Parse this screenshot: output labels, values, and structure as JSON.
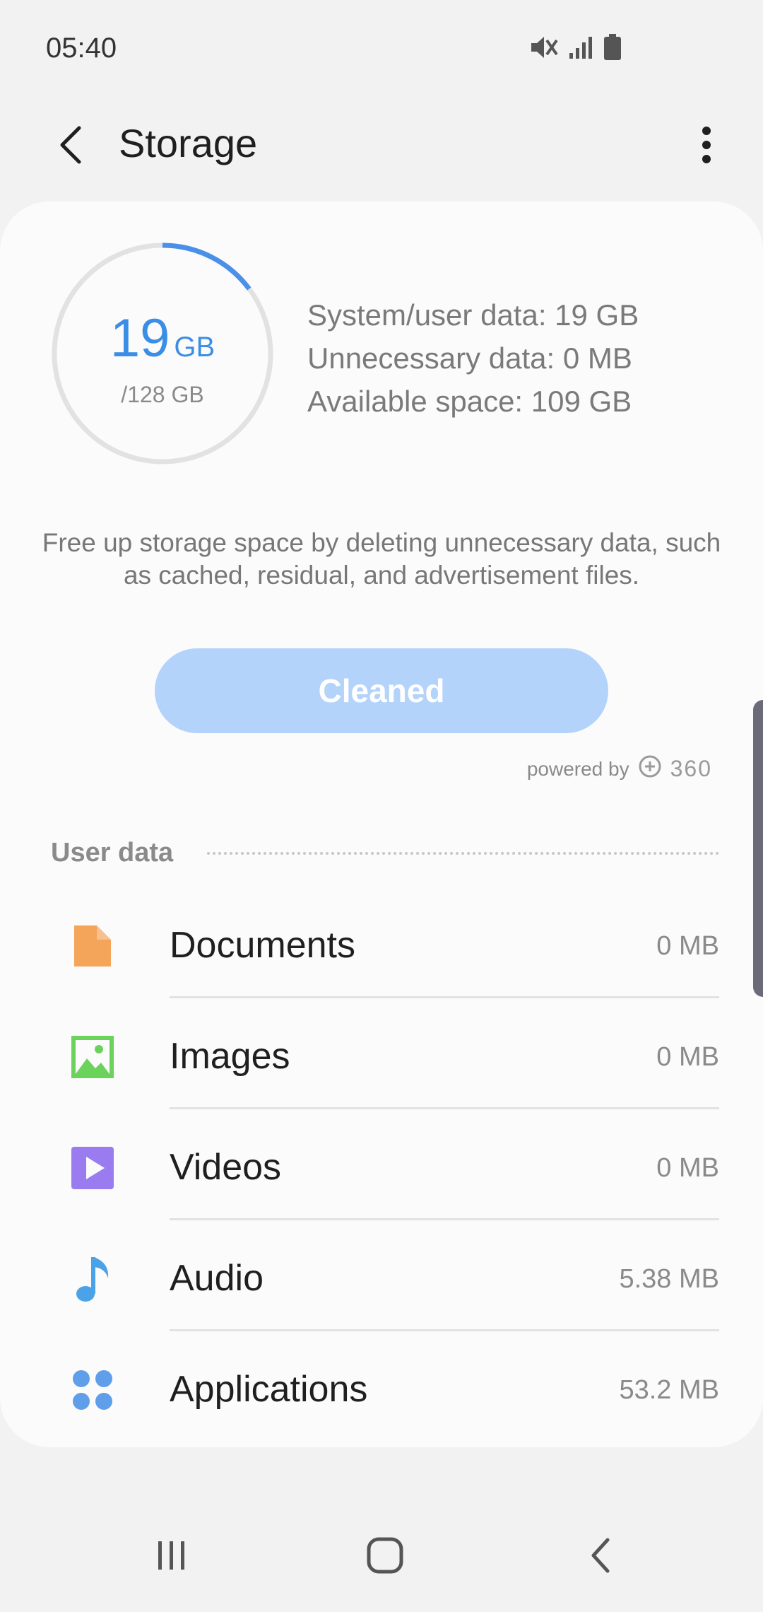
{
  "status_bar": {
    "time": "05:40",
    "icons": [
      "mute-icon",
      "signal-icon",
      "battery-icon"
    ]
  },
  "app_bar": {
    "title": "Storage",
    "back_icon": "back-arrow-icon",
    "more_icon": "more-vert-icon"
  },
  "gauge": {
    "used_value": "19",
    "used_unit": "GB",
    "total": "/128 GB",
    "fraction_used": 0.148,
    "track_color": "#e2e2e2",
    "fill_color": "#4a90e8"
  },
  "summary": {
    "system_user": "System/user data: 19 GB",
    "unnecessary": "Unnecessary data: 0 MB",
    "available": "Available space: 109 GB"
  },
  "description": "Free up storage space by deleting unnecessary data, such as cached, residual, and advertisement files.",
  "clean_button": {
    "label": "Cleaned",
    "color": "#b3d3fb"
  },
  "powered_by": {
    "label": "powered by",
    "brand": "360"
  },
  "section": {
    "title": "User data"
  },
  "items": [
    {
      "label": "Documents",
      "size": "0 MB",
      "icon": "document-icon",
      "color": "#f5a55a"
    },
    {
      "label": "Images",
      "size": "0 MB",
      "icon": "image-icon",
      "color": "#6bd35c"
    },
    {
      "label": "Videos",
      "size": "0 MB",
      "icon": "video-icon",
      "color": "#9a7cf0"
    },
    {
      "label": "Audio",
      "size": "5.38 MB",
      "icon": "music-note-icon",
      "color": "#4aa3e8"
    },
    {
      "label": "Applications",
      "size": "53.2 MB",
      "icon": "apps-icon",
      "color": "#5f9ee8"
    }
  ],
  "nav_bar": {
    "recents": "recents-icon",
    "home": "home-icon",
    "back": "nav-back-icon"
  }
}
